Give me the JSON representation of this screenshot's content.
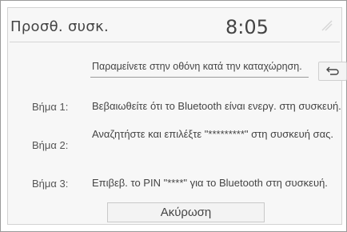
{
  "header": {
    "title": "Προσθ. συσκ.",
    "time": "8:05"
  },
  "message": "Παραμείνετε στην οθόνη κατά την καταχώρηση.",
  "steps": [
    {
      "label": "Βήμα 1:",
      "text": "Βεβαιωθείτε ότι το Bluetooth είναι ενεργ. στη συσκευή."
    },
    {
      "label": "Βήμα 2:",
      "text": "Αναζητήστε και επιλέξτε \"*********\" στη συσκευή σας."
    },
    {
      "label": "Βήμα 3:",
      "text": "Επιβεβ. το PIN \"****\" για το Bluetooth στη συσκευή."
    }
  ],
  "buttons": {
    "cancel": "Ακύρωση"
  },
  "icons": {
    "back": "back-arrow-icon",
    "status": "status-icon"
  }
}
